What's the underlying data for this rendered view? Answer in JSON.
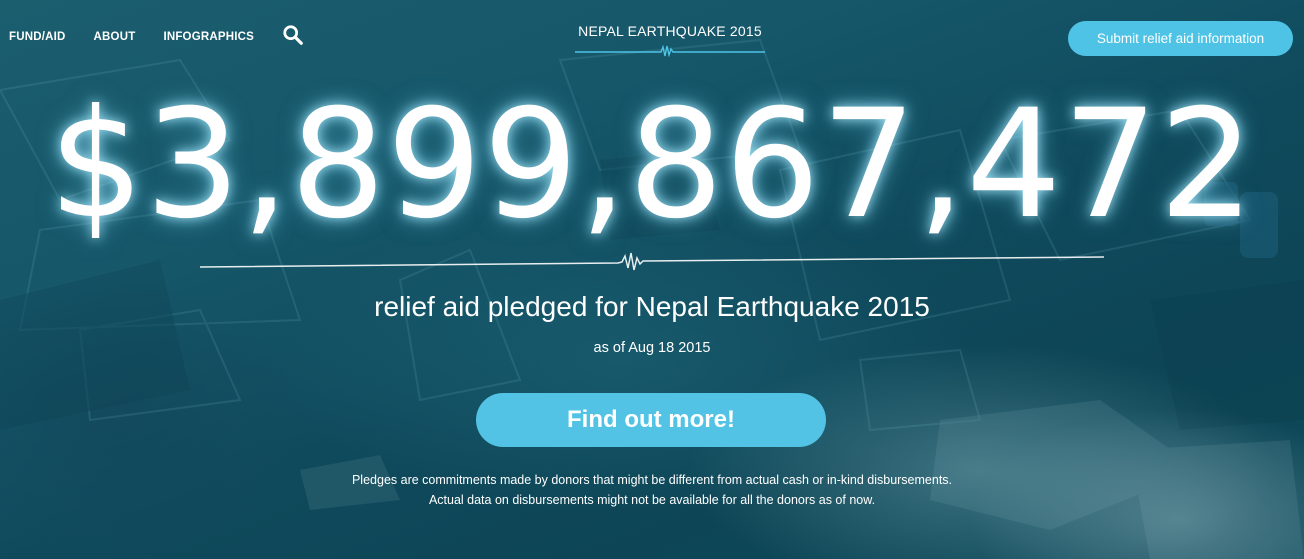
{
  "nav": {
    "items": [
      {
        "label": "FUND/AID"
      },
      {
        "label": "ABOUT"
      },
      {
        "label": "INFOGRAPHICS"
      }
    ],
    "search_icon": "search-icon"
  },
  "header": {
    "title": "NEPAL EARTHQUAKE 2015",
    "submit_label": "Submit relief aid information"
  },
  "hero": {
    "amount": "$3,899,867,472",
    "subtitle": "relief aid pledged for Nepal Earthquake 2015",
    "date": "as of Aug 18 2015",
    "cta_label": "Find out more!",
    "disclaimer_line1": "Pledges are commitments made by donors that might be different from actual cash or in-kind disbursements.",
    "disclaimer_line2": "Actual data on disbursements might not be available for all the donors as of now."
  },
  "colors": {
    "accent": "#4ec3e5",
    "background": "#145466",
    "text": "#ffffff"
  }
}
